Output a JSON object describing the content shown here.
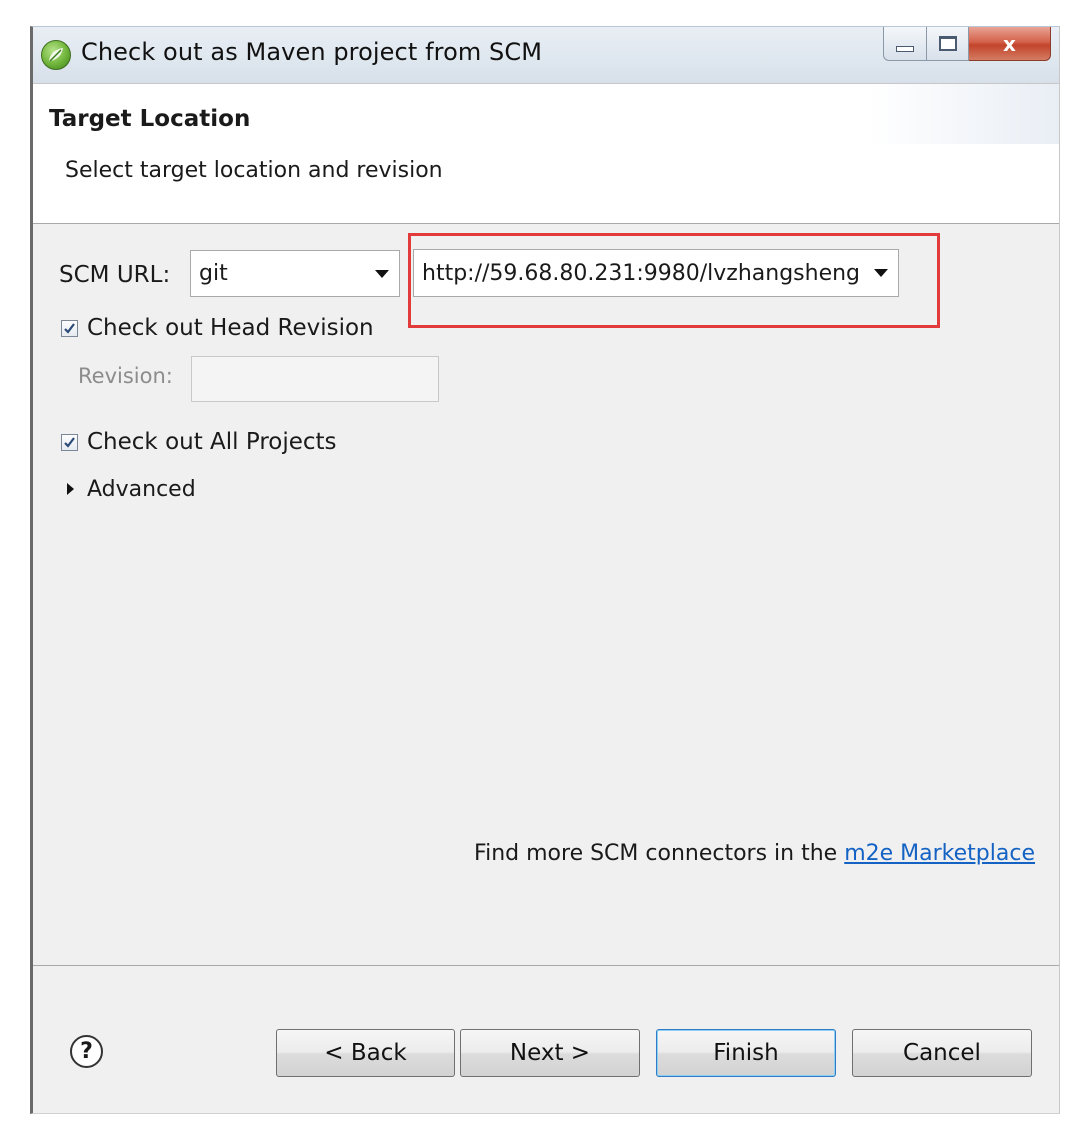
{
  "window": {
    "title": "Check out as Maven project from SCM",
    "icon": "spring-leaf-icon",
    "controls": [
      "minimize-icon",
      "maximize-icon",
      "close-icon"
    ],
    "close_glyph": "x"
  },
  "banner": {
    "title": "Target Location",
    "description": "Select target location and revision"
  },
  "form": {
    "scm_url_label": "SCM URL:",
    "scm_type": "git",
    "scm_url": "http://59.68.80.231:9980/lvzhangsheng",
    "head_revision_label": "Check out Head Revision",
    "head_revision_checked": true,
    "revision_label": "Revision:",
    "revision_value": "",
    "all_projects_label": "Check out All Projects",
    "all_projects_checked": true,
    "advanced_label": "Advanced"
  },
  "marketplace": {
    "text": "Find more SCM connectors in the",
    "link": "m2e Marketplace"
  },
  "buttons": {
    "help": "?",
    "back": "< Back",
    "next": "Next >",
    "finish": "Finish",
    "cancel": "Cancel"
  },
  "colors": {
    "highlight": "#e23b3b",
    "link": "#1463c4"
  }
}
